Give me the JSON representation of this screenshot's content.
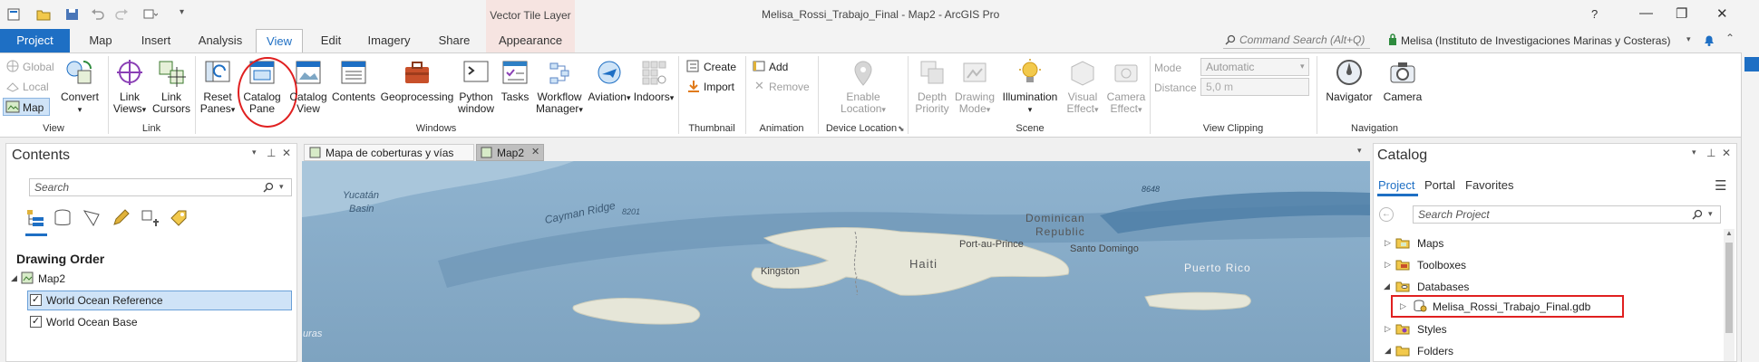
{
  "window": {
    "title": "Melisa_Rossi_Trabajo_Final - Map2 - ArcGIS Pro",
    "context_tab_group": "Vector Tile Layer",
    "help": "?",
    "minimize": "—",
    "restore": "❐",
    "close": "✕"
  },
  "tabs": [
    "Project",
    "Map",
    "Insert",
    "Analysis",
    "View",
    "Edit",
    "Imagery",
    "Share",
    "Appearance"
  ],
  "command_search": {
    "placeholder": "Command Search (Alt+Q)"
  },
  "user": {
    "name": "Melisa (Instituto de Investigaciones Marinas y Costeras)"
  },
  "ribbon": {
    "view_group": {
      "label": "View",
      "global": "Global",
      "local": "Local",
      "map": "Map",
      "convert": "Convert"
    },
    "link_group": {
      "label": "Link",
      "link_views_1": "Link",
      "link_views_2": "Views",
      "link_cursors_1": "Link",
      "link_cursors_2": "Cursors"
    },
    "windows_group": {
      "label": "Windows",
      "reset_panes_1": "Reset",
      "reset_panes_2": "Panes",
      "catalog_pane_1": "Catalog",
      "catalog_pane_2": "Pane",
      "catalog_view_1": "Catalog",
      "catalog_view_2": "View",
      "contents": "Contents",
      "geoprocessing": "Geoprocessing",
      "python_window_1": "Python",
      "python_window_2": "window",
      "tasks": "Tasks",
      "workflow_manager_1": "Workflow",
      "workflow_manager_2": "Manager",
      "aviation": "Aviation",
      "indoors": "Indoors"
    },
    "thumbnail_group": {
      "label": "Thumbnail",
      "create": "Create",
      "import": "Import"
    },
    "animation_group": {
      "label": "Animation",
      "add": "Add",
      "remove": "Remove"
    },
    "device_location_group": {
      "label": "Device Location",
      "enable_location_1": "Enable",
      "enable_location_2": "Location"
    },
    "scene_group": {
      "label": "Scene",
      "depth_priority_1": "Depth",
      "depth_priority_2": "Priority",
      "drawing_mode_1": "Drawing",
      "drawing_mode_2": "Mode",
      "illumination": "Illumination",
      "visual_effect_1": "Visual",
      "visual_effect_2": "Effect",
      "camera_effect_1": "Camera",
      "camera_effect_2": "Effect"
    },
    "view_clipping_group": {
      "label": "View Clipping",
      "mode_label": "Mode",
      "mode_value": "Automatic",
      "distance_label": "Distance",
      "distance_value": "5,0 m"
    },
    "navigation_group": {
      "label": "Navigation",
      "navigator": "Navigator",
      "camera": "Camera"
    }
  },
  "contents_pane": {
    "title": "Contents",
    "search_placeholder": "Search",
    "section_title": "Drawing Order",
    "map_name": "Map2",
    "layers": [
      "World Ocean Reference",
      "World Ocean Base"
    ]
  },
  "map_tabs": [
    "Mapa de coberturas y vías",
    "Map2"
  ],
  "map_labels": {
    "yucatan_1": "Yucatán",
    "yucatan_2": "Basin",
    "cayman_ridge": "Cayman Ridge",
    "depth_8201": "8201",
    "depth_8648": "8648",
    "dominican_1": "Dominican",
    "dominican_2": "Republic",
    "port_au_prince": "Port-au-Prince",
    "santo_domingo": "Santo Domingo",
    "haiti": "Haiti",
    "kingston": "Kingston",
    "puerto_rico": "Puerto Rico",
    "partial_left": "uras"
  },
  "catalog_pane": {
    "title": "Catalog",
    "tabs": [
      "Project",
      "Portal",
      "Favorites"
    ],
    "search_placeholder": "Search Project",
    "items": [
      "Maps",
      "Toolboxes",
      "Databases",
      "Melisa_Rossi_Trabajo_Final.gdb",
      "Styles",
      "Folders"
    ]
  },
  "colors": {
    "accent": "#1e6fc4",
    "highlight_circle": "#e02020",
    "highlight_box": "#e02020",
    "ocean": "#7ea7c5",
    "land": "#e6e6d8"
  }
}
